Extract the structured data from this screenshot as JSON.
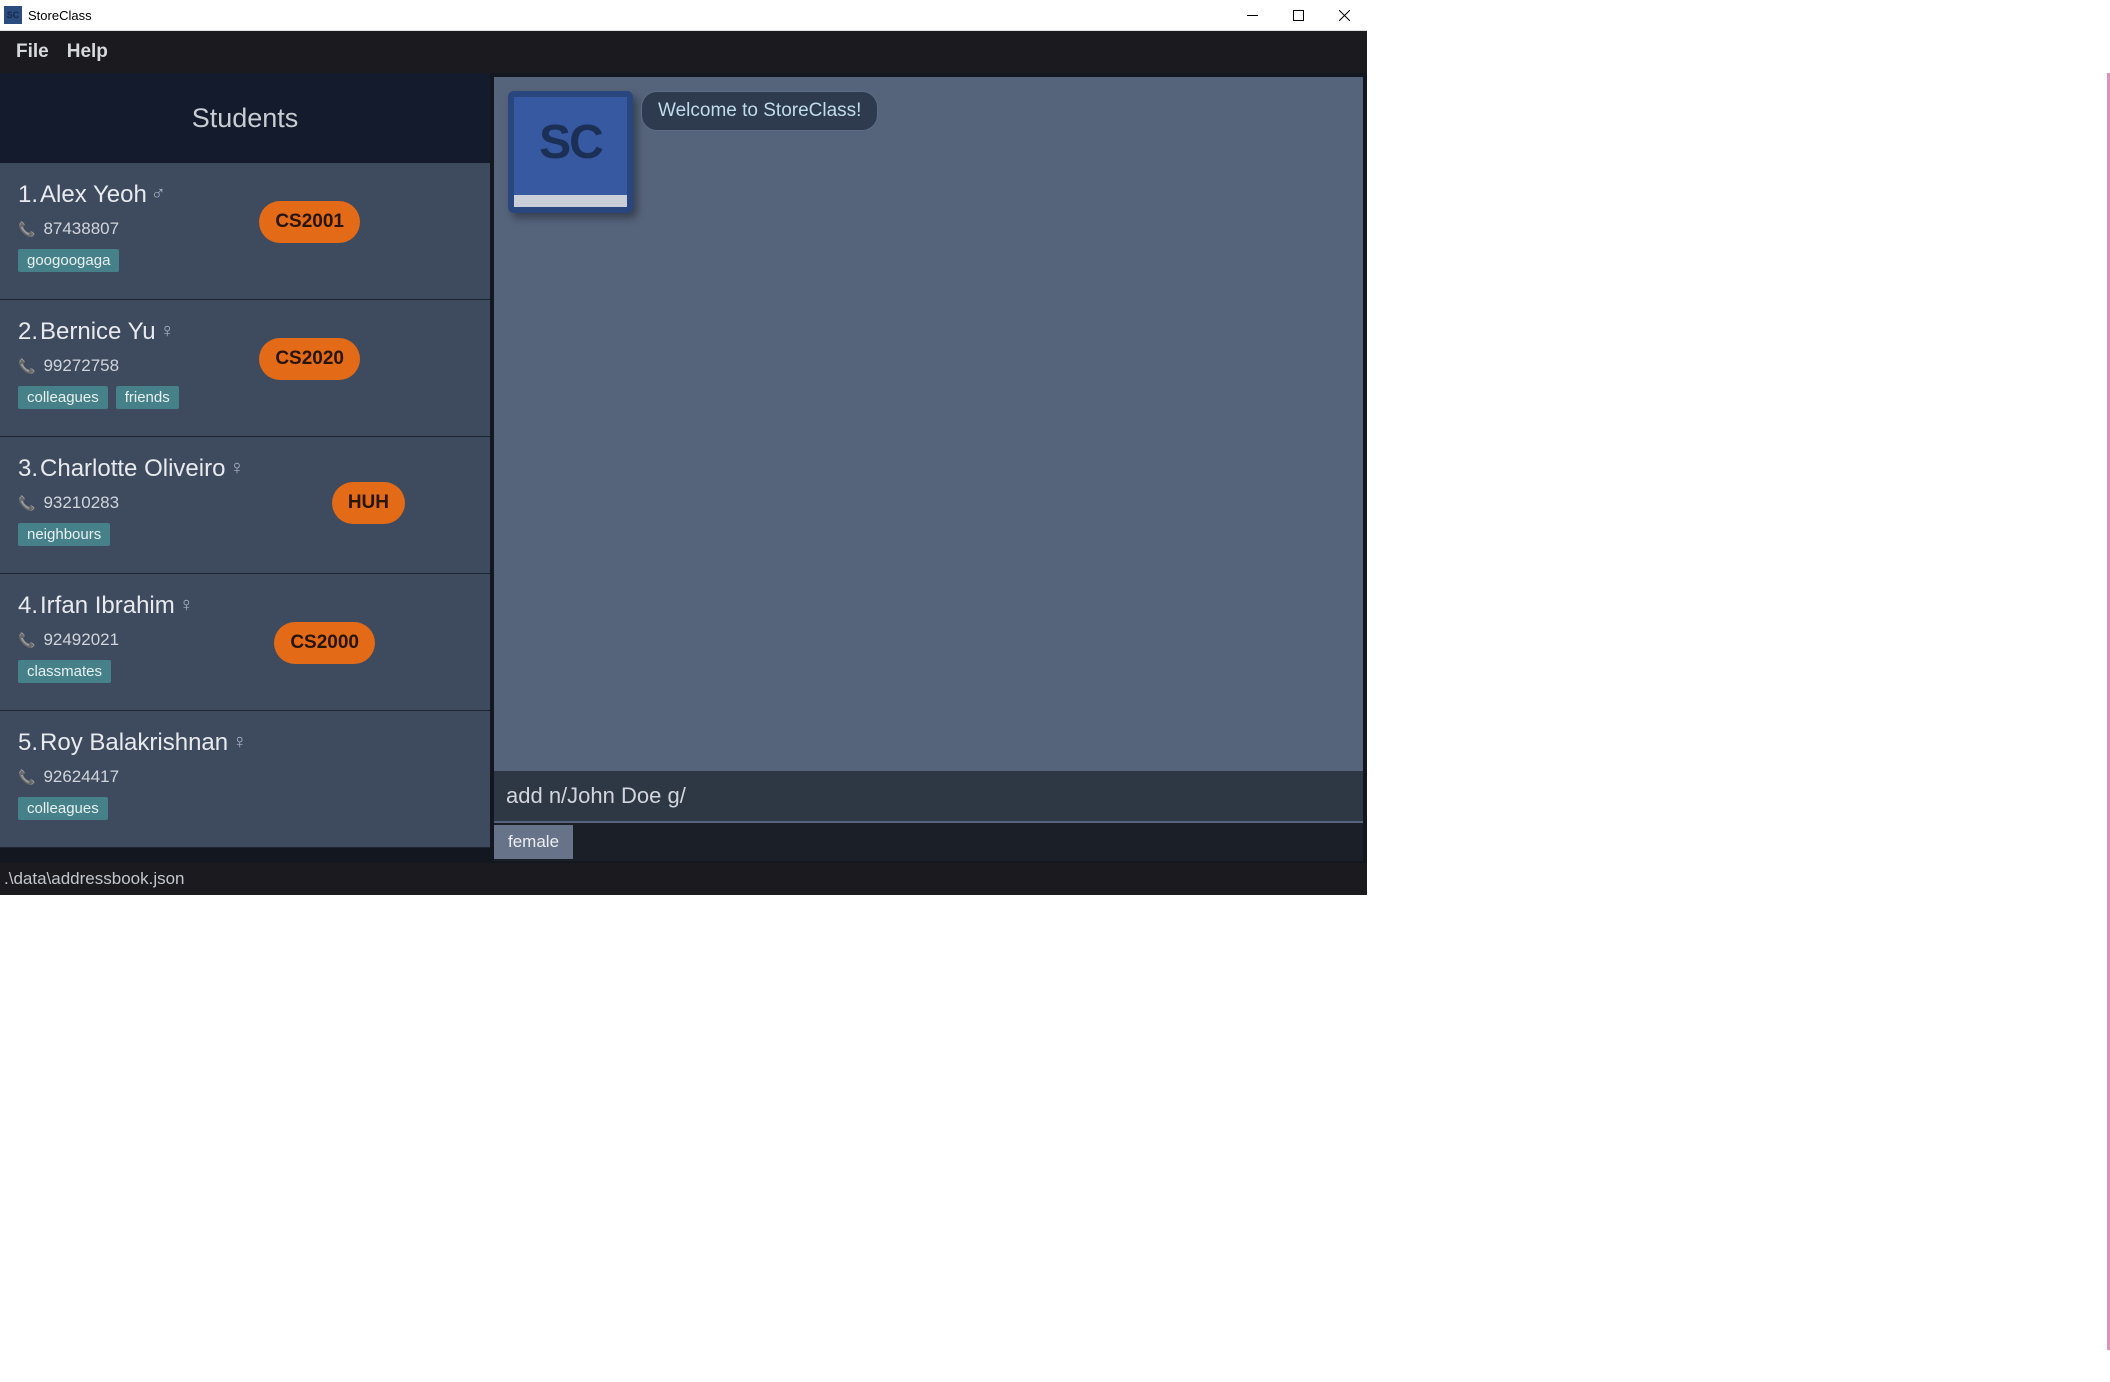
{
  "window": {
    "title": "StoreClass"
  },
  "menu": {
    "file": "File",
    "help": "Help"
  },
  "sidebar": {
    "header": "Students",
    "students": [
      {
        "idx": "1.",
        "name": "Alex Yeoh",
        "gender": "male",
        "phone": "87438807",
        "tags": [
          "googoogaga"
        ],
        "class": "CS2001"
      },
      {
        "idx": "2.",
        "name": "Bernice Yu",
        "gender": "female",
        "phone": "99272758",
        "tags": [
          "colleagues",
          "friends"
        ],
        "class": "CS2020"
      },
      {
        "idx": "3.",
        "name": "Charlotte Oliveiro",
        "gender": "female",
        "phone": "93210283",
        "tags": [
          "neighbours"
        ],
        "class": "HUH"
      },
      {
        "idx": "4.",
        "name": "Irfan Ibrahim",
        "gender": "female",
        "phone": "92492021",
        "tags": [
          "classmates"
        ],
        "class": "CS2000"
      },
      {
        "idx": "5.",
        "name": "Roy Balakrishnan",
        "gender": "female",
        "phone": "92624417",
        "tags": [
          "colleagues"
        ],
        "class": ""
      }
    ]
  },
  "main": {
    "logo_text": "SC",
    "welcome": "Welcome to StoreClass!"
  },
  "command": {
    "value": "add n/John Doe g/",
    "suggestion": "female"
  },
  "status": {
    "path": ".\\data\\addressbook.json"
  }
}
